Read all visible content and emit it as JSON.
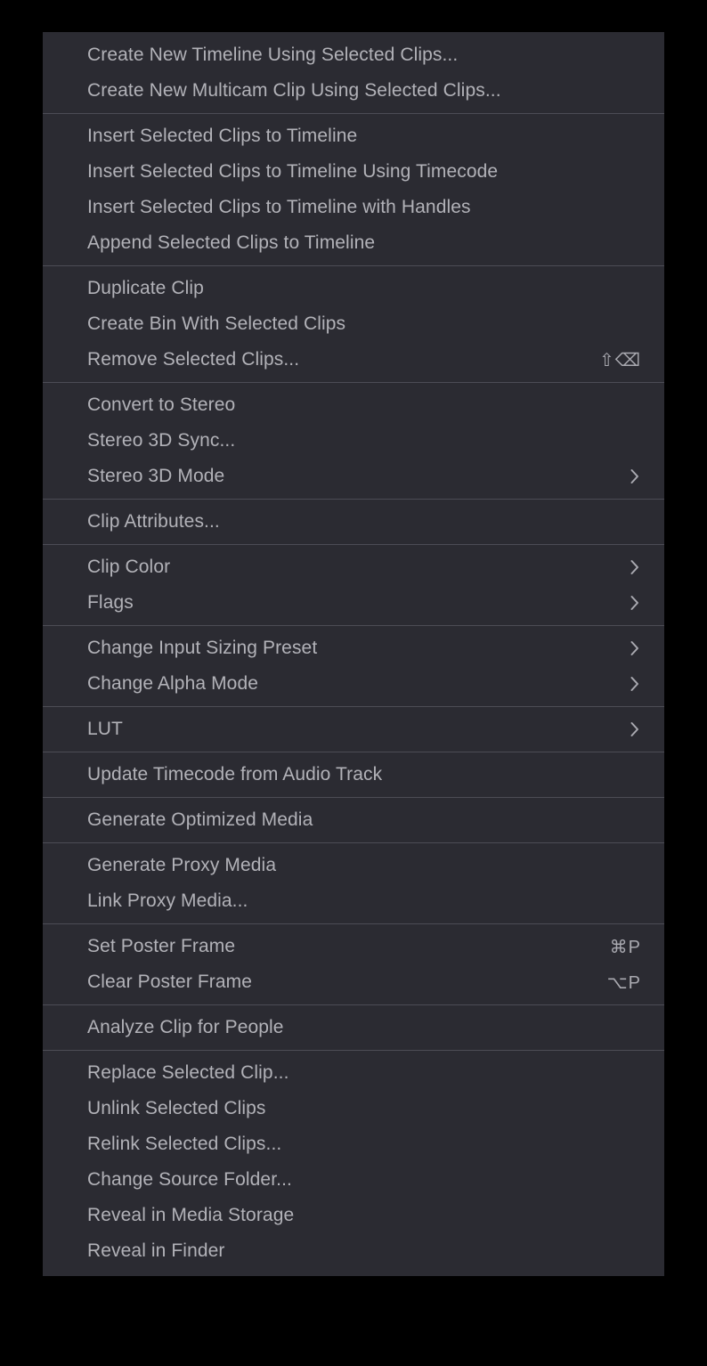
{
  "menu": {
    "name": "clip-context-menu",
    "background_color": "#2b2b32",
    "separator_color": "#4c4c55",
    "text_color": "#b2b2b8",
    "groups": [
      {
        "items": [
          {
            "label": "Create New Timeline Using Selected Clips...",
            "shortcut": "",
            "submenu": false
          },
          {
            "label": "Create New Multicam Clip Using Selected Clips...",
            "shortcut": "",
            "submenu": false
          }
        ]
      },
      {
        "items": [
          {
            "label": "Insert Selected Clips to Timeline",
            "shortcut": "",
            "submenu": false
          },
          {
            "label": "Insert Selected Clips to Timeline Using Timecode",
            "shortcut": "",
            "submenu": false
          },
          {
            "label": "Insert Selected Clips to Timeline with Handles",
            "shortcut": "",
            "submenu": false
          },
          {
            "label": "Append Selected Clips to Timeline",
            "shortcut": "",
            "submenu": false
          }
        ]
      },
      {
        "items": [
          {
            "label": "Duplicate Clip",
            "shortcut": "",
            "submenu": false
          },
          {
            "label": "Create Bin With Selected Clips",
            "shortcut": "",
            "submenu": false
          },
          {
            "label": "Remove Selected Clips...",
            "shortcut": "⇧⌫",
            "submenu": false
          }
        ]
      },
      {
        "items": [
          {
            "label": "Convert to Stereo",
            "shortcut": "",
            "submenu": false
          },
          {
            "label": "Stereo 3D Sync...",
            "shortcut": "",
            "submenu": false
          },
          {
            "label": "Stereo 3D Mode",
            "shortcut": "",
            "submenu": true
          }
        ]
      },
      {
        "items": [
          {
            "label": "Clip Attributes...",
            "shortcut": "",
            "submenu": false
          }
        ]
      },
      {
        "items": [
          {
            "label": "Clip Color",
            "shortcut": "",
            "submenu": true
          },
          {
            "label": "Flags",
            "shortcut": "",
            "submenu": true
          }
        ]
      },
      {
        "items": [
          {
            "label": "Change Input Sizing Preset",
            "shortcut": "",
            "submenu": true
          },
          {
            "label": "Change Alpha Mode",
            "shortcut": "",
            "submenu": true
          }
        ]
      },
      {
        "items": [
          {
            "label": "LUT",
            "shortcut": "",
            "submenu": true
          }
        ]
      },
      {
        "items": [
          {
            "label": "Update Timecode from Audio Track",
            "shortcut": "",
            "submenu": false
          }
        ]
      },
      {
        "items": [
          {
            "label": "Generate Optimized Media",
            "shortcut": "",
            "submenu": false
          }
        ]
      },
      {
        "items": [
          {
            "label": "Generate Proxy Media",
            "shortcut": "",
            "submenu": false
          },
          {
            "label": "Link Proxy Media...",
            "shortcut": "",
            "submenu": false
          }
        ]
      },
      {
        "items": [
          {
            "label": "Set Poster Frame",
            "shortcut": "⌘P",
            "submenu": false
          },
          {
            "label": "Clear Poster Frame",
            "shortcut": "⌥P",
            "submenu": false
          }
        ]
      },
      {
        "items": [
          {
            "label": "Analyze Clip for People",
            "shortcut": "",
            "submenu": false
          }
        ]
      },
      {
        "items": [
          {
            "label": "Replace Selected Clip...",
            "shortcut": "",
            "submenu": false
          },
          {
            "label": "Unlink Selected Clips",
            "shortcut": "",
            "submenu": false
          },
          {
            "label": "Relink Selected Clips...",
            "shortcut": "",
            "submenu": false
          },
          {
            "label": "Change Source Folder...",
            "shortcut": "",
            "submenu": false
          },
          {
            "label": "Reveal in Media Storage",
            "shortcut": "",
            "submenu": false
          },
          {
            "label": "Reveal in Finder",
            "shortcut": "",
            "submenu": false
          }
        ]
      }
    ]
  }
}
